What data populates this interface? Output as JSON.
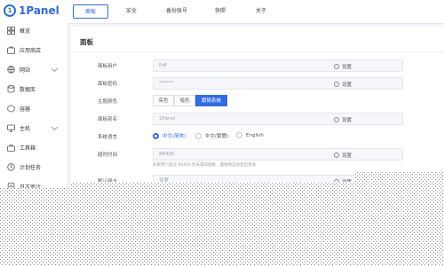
{
  "brand": {
    "name": "1Panel"
  },
  "sidebar": {
    "items": [
      {
        "label": "概览",
        "icon": "overview-icon"
      },
      {
        "label": "应用商店",
        "icon": "app-store-icon"
      },
      {
        "label": "网站",
        "icon": "website-icon",
        "expandable": true
      },
      {
        "label": "数据库",
        "icon": "database-icon"
      },
      {
        "label": "容器",
        "icon": "container-icon"
      },
      {
        "label": "主机",
        "icon": "host-icon",
        "expandable": true
      },
      {
        "label": "工具箱",
        "icon": "toolbox-icon"
      },
      {
        "label": "计划任务",
        "icon": "cron-icon"
      },
      {
        "label": "日志审计",
        "icon": "log-icon"
      }
    ]
  },
  "tabs": {
    "items": [
      {
        "label": "面板",
        "active": true
      },
      {
        "label": "安全"
      },
      {
        "label": "备份账号"
      },
      {
        "label": "快照"
      },
      {
        "label": "关于"
      }
    ]
  },
  "panel": {
    "title": "面板",
    "rows": {
      "username": {
        "label": "面板用户",
        "value": "Pdf",
        "action": "设置"
      },
      "password": {
        "label": "面板密码",
        "value": "******",
        "action": "设置"
      },
      "theme": {
        "label": "主题颜色",
        "options": [
          "亮色",
          "暗色",
          "跟随系统"
        ],
        "selected": "跟随系统"
      },
      "panel_name": {
        "label": "面板别名",
        "value": "1Panel"
      },
      "language": {
        "label": "系统语言",
        "options": [
          "中文(简体)",
          "中文(繁體)",
          "English"
        ],
        "selected": "中文(简体)"
      },
      "timeout": {
        "label": "超时时间",
        "value": "86400",
        "hint": "如果用户超过 86400 秒未操作面板，面板将自动退出登录"
      },
      "default_network": {
        "label": "默认网卡",
        "value": "设置",
        "action": "设置"
      }
    }
  },
  "colors": {
    "accent": "#2f6bea",
    "sidebar_bg": "#ffffff",
    "page_bg": "#f3f5f9"
  }
}
